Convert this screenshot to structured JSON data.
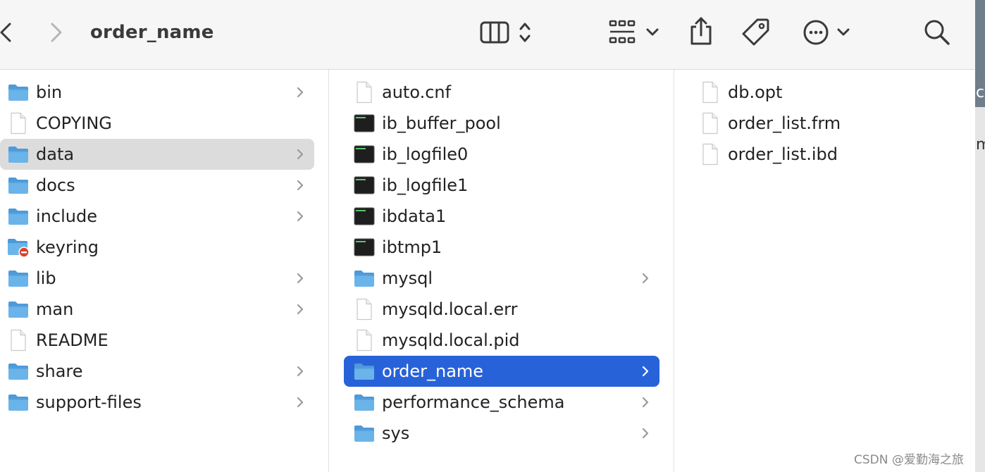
{
  "window": {
    "title": "order_name"
  },
  "toolbar": {
    "back": "chevron-left-icon",
    "forward": "chevron-right-icon",
    "view": "columns-view-icon",
    "group": "grid-view-icon",
    "share": "share-icon",
    "tag": "tag-icon",
    "more": "ellipsis-icon",
    "search": "search-icon"
  },
  "columns": [
    {
      "items": [
        {
          "label": "bin",
          "kind": "folder",
          "chevron": true
        },
        {
          "label": "COPYING",
          "kind": "file",
          "chevron": false
        },
        {
          "label": "data",
          "kind": "folder",
          "chevron": true,
          "selected": "inactive"
        },
        {
          "label": "docs",
          "kind": "folder",
          "chevron": true
        },
        {
          "label": "include",
          "kind": "folder",
          "chevron": true
        },
        {
          "label": "keyring",
          "kind": "folder-restricted",
          "chevron": false
        },
        {
          "label": "lib",
          "kind": "folder",
          "chevron": true
        },
        {
          "label": "man",
          "kind": "folder",
          "chevron": true
        },
        {
          "label": "README",
          "kind": "file",
          "chevron": false
        },
        {
          "label": "share",
          "kind": "folder",
          "chevron": true
        },
        {
          "label": "support-files",
          "kind": "folder",
          "chevron": true
        }
      ]
    },
    {
      "items": [
        {
          "label": "auto.cnf",
          "kind": "file",
          "chevron": false
        },
        {
          "label": "ib_buffer_pool",
          "kind": "exec",
          "chevron": false
        },
        {
          "label": "ib_logfile0",
          "kind": "exec",
          "chevron": false
        },
        {
          "label": "ib_logfile1",
          "kind": "exec",
          "chevron": false
        },
        {
          "label": "ibdata1",
          "kind": "exec",
          "chevron": false
        },
        {
          "label": "ibtmp1",
          "kind": "exec",
          "chevron": false
        },
        {
          "label": "mysql",
          "kind": "folder",
          "chevron": true
        },
        {
          "label": "mysqld.local.err",
          "kind": "file",
          "chevron": false
        },
        {
          "label": "mysqld.local.pid",
          "kind": "file",
          "chevron": false
        },
        {
          "label": "order_name",
          "kind": "folder",
          "chevron": true,
          "selected": "active"
        },
        {
          "label": "performance_schema",
          "kind": "folder",
          "chevron": true
        },
        {
          "label": "sys",
          "kind": "folder",
          "chevron": true
        }
      ]
    },
    {
      "items": [
        {
          "label": "db.opt",
          "kind": "file",
          "chevron": false
        },
        {
          "label": "order_list.frm",
          "kind": "file",
          "chevron": false
        },
        {
          "label": "order_list.ibd",
          "kind": "file",
          "chevron": false
        }
      ]
    }
  ],
  "colors": {
    "folder": "#6bb4ea",
    "folder_tab": "#4c9ad9",
    "selection_active": "#2862d9",
    "selection_inactive": "#dcdcdc",
    "restricted_badge": "#d9412e"
  },
  "watermark": "CSDN @爱勤海之旅",
  "edge_fragments": [
    "c",
    "m"
  ]
}
